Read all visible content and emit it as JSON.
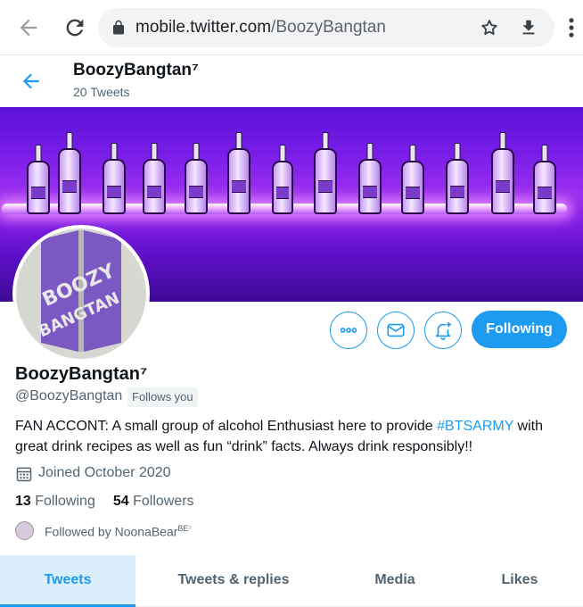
{
  "browser": {
    "url_host": "mobile.twitter.com",
    "url_path": "/BoozyBangtan",
    "icons": [
      "back-arrow-icon",
      "reload-icon",
      "lock-icon",
      "star-icon",
      "download-icon",
      "more-vert-icon"
    ]
  },
  "header": {
    "name": "BoozyBangtan⁷",
    "tweet_count": "20 Tweets"
  },
  "avatar": {
    "line1": "BOOZY",
    "line2": "BANGTAN"
  },
  "actions": {
    "more_icon": "more-horizontal-icon",
    "message_icon": "mail-icon",
    "notify_icon": "bell-plus-icon",
    "follow_label": "Following"
  },
  "profile": {
    "name": "BoozyBangtan⁷",
    "handle": "@BoozyBangtan",
    "follows_you": "Follows you",
    "bio_before": "FAN ACCONT: A small group of alcohol Enthusiast here to provide ",
    "bio_hashtag": "#BTSARMY",
    "bio_after": " with great drink recipes as well as fun “drink” facts. Always drink responsibly!!",
    "joined": "Joined October 2020",
    "following_count": "13",
    "following_label": "Following",
    "followers_count": "54",
    "followers_label": "Followers",
    "followed_by_prefix": "Followed by ",
    "followed_by_name": "NoonaBear",
    "followed_by_sup": "BE⁷"
  },
  "tabs": [
    {
      "label": "Tweets",
      "active": true
    },
    {
      "label": "Tweets & replies",
      "active": false
    },
    {
      "label": "Media",
      "active": false
    },
    {
      "label": "Likes",
      "active": false
    }
  ],
  "colors": {
    "accent": "#1d9bf0",
    "text_primary": "#0f1419",
    "text_secondary": "#536471",
    "banner_purple": "#7a1ee8"
  }
}
